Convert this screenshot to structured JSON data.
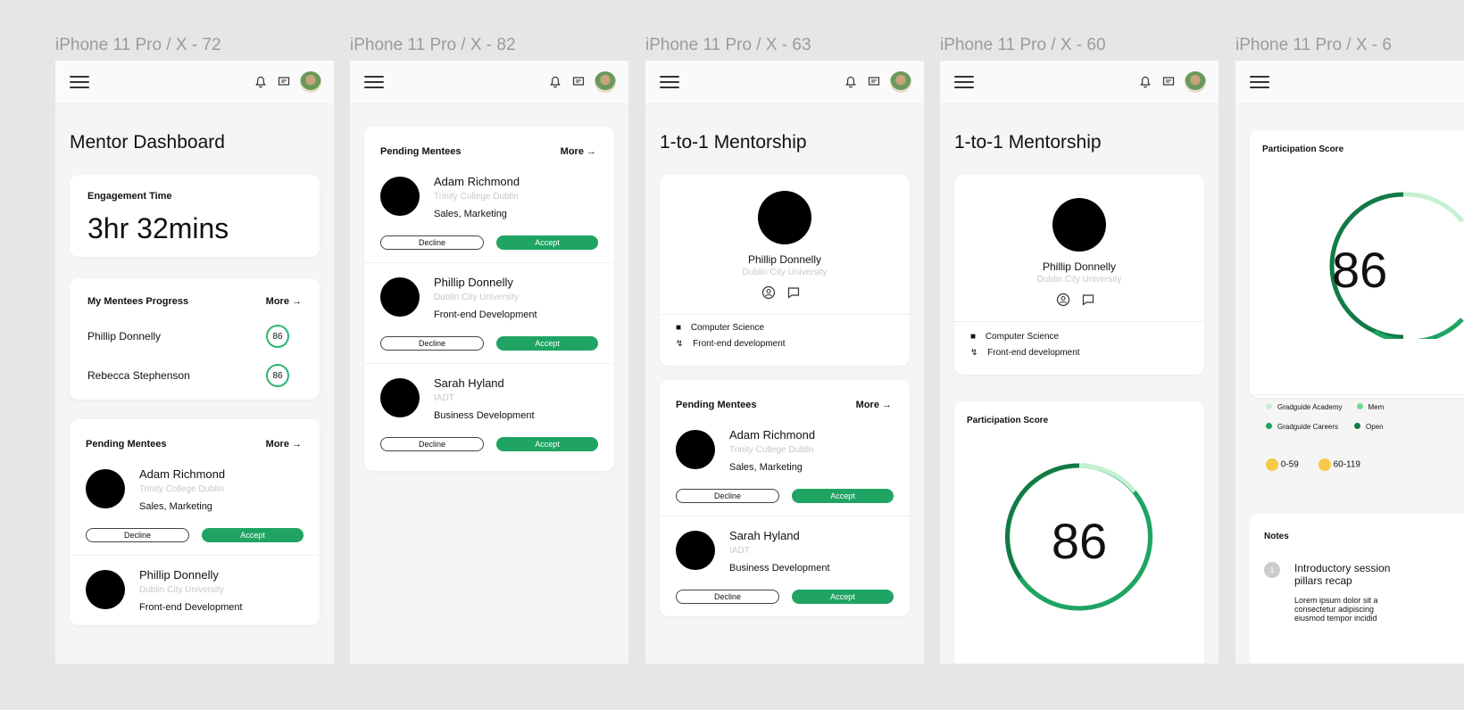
{
  "frames": [
    {
      "title": "iPhone 11 Pro / X - 72"
    },
    {
      "title": "iPhone 11 Pro / X - 82"
    },
    {
      "title": "iPhone 11 Pro / X - 63"
    },
    {
      "title": "iPhone 11 Pro / X - 60"
    },
    {
      "title": "iPhone 11 Pro / X - 6"
    }
  ],
  "colors": {
    "accent": "#1fa463",
    "accent_light": "#8fe3a8",
    "accent_dark": "#127a46"
  },
  "mentor_dashboard": {
    "title": "Mentor Dashboard",
    "engagement_label": "Engagement Time",
    "engagement_value": "3hr 32mins",
    "progress_title": "My Mentees Progress",
    "more": "More →",
    "progress": [
      {
        "name": "Phillip Donnelly",
        "score": "86"
      },
      {
        "name": "Rebecca Stephenson",
        "score": "86"
      }
    ]
  },
  "pending": {
    "title": "Pending Mentees",
    "more": "More →",
    "decline": "Decline",
    "accept": "Accept",
    "mentees": [
      {
        "name": "Adam Richmond",
        "school": "Trinity College Dublin",
        "field": "Sales, Marketing"
      },
      {
        "name": "Phillip Donnelly",
        "school": "Dublin City University",
        "field": "Front-end Development"
      },
      {
        "name": "Sarah Hyland",
        "school": "IADT",
        "field": "Business Development"
      }
    ]
  },
  "mentorship": {
    "title": "1-to-1 Mentorship",
    "name": "Phillip Donnelly",
    "school": "Dublin City University",
    "course": "Computer Science",
    "interest": "Front-end development"
  },
  "participation": {
    "title": "Participation Score",
    "score": "86",
    "score_fraction": 0.86,
    "legend": [
      "Gradguide Academy",
      "Mem",
      "Gradguide Careers",
      "Open"
    ],
    "ranges": [
      "0-59",
      "60-119"
    ]
  },
  "notes": {
    "title": "Notes",
    "item_number": "1",
    "item_title": "Introductory session",
    "item_title_2": "pillars recap",
    "item_body_1": "Lorem ipsum dolor sit a",
    "item_body_2": "consectetur adipiscing",
    "item_body_3": "eiusmod tempor incidid"
  }
}
